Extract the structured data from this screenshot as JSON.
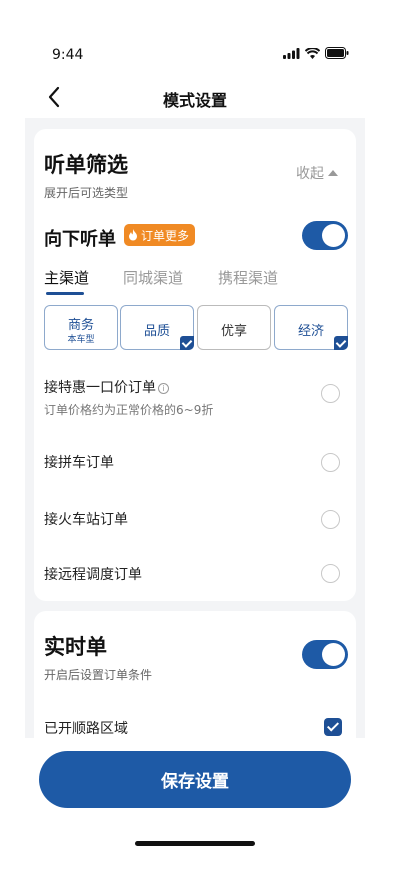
{
  "status_bar": {
    "time": "9:44"
  },
  "header": {
    "title": "模式设置"
  },
  "filter_card": {
    "title": "听单筛选",
    "subtitle": "展开后可选类型",
    "collapse_label": "收起",
    "down_listen": {
      "label": "向下听单",
      "badge": "订单更多",
      "enabled": true
    },
    "tabs": [
      "主渠道",
      "同城渠道",
      "携程渠道"
    ],
    "active_tab": "主渠道",
    "options": [
      {
        "label": "商务",
        "sub": "本车型",
        "checked": false
      },
      {
        "label": "品质",
        "sub": "",
        "checked": true
      },
      {
        "label": "优享",
        "sub": "",
        "checked": false
      },
      {
        "label": "经济",
        "sub": "",
        "checked": true
      }
    ],
    "rows": [
      {
        "label": "接特惠一口价订单",
        "sub": "订单价格约为正常价格的6~9折",
        "info_icon": "i",
        "selected": false
      },
      {
        "label": "接拼车订单",
        "selected": false
      },
      {
        "label": "接火车站订单",
        "selected": false
      },
      {
        "label": "接远程调度订单",
        "selected": false
      }
    ]
  },
  "realtime_card": {
    "title": "实时单",
    "subtitle": "开启后设置订单条件",
    "enabled": true,
    "route_area": {
      "label": "已开顺路区域",
      "checked": true
    }
  },
  "footer": {
    "save_label": "保存设置"
  },
  "colors": {
    "primary": "#1e5aa6",
    "badge": "#f08a24",
    "background": "#f3f4f6"
  }
}
